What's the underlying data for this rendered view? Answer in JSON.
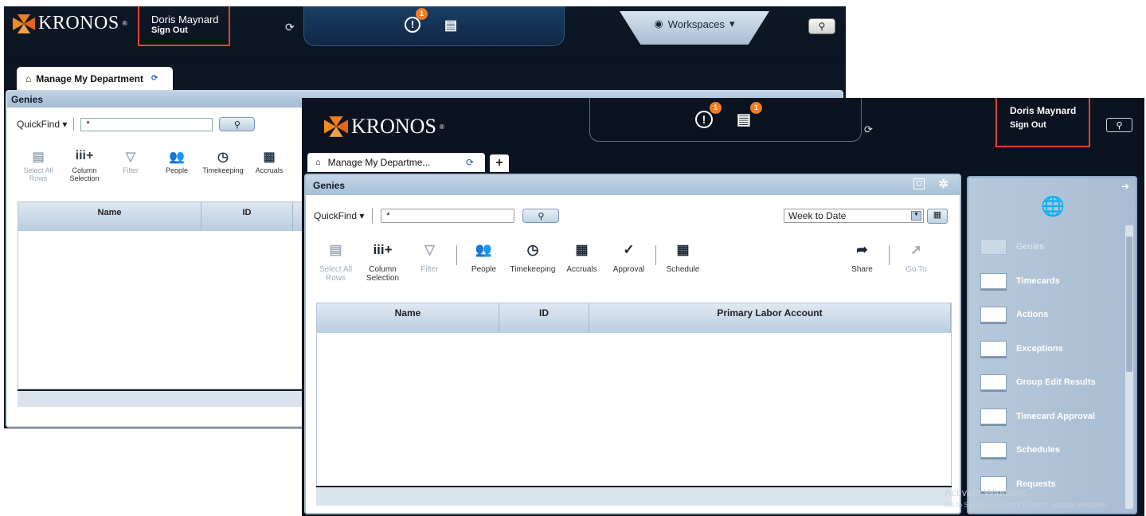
{
  "back": {
    "logo": "KRONOS",
    "logo_reg": "®",
    "user": {
      "name": "Doris Maynard",
      "signout": "Sign Out"
    },
    "notif_count": "1",
    "workspaces_label": "Workspaces",
    "tab": {
      "label": "Manage My Department"
    },
    "panel_title": "Genies",
    "quickfind": {
      "label": "QuickFind",
      "value": "*"
    },
    "tools": [
      {
        "label": "Select All Rows",
        "icon": "select-all-icon"
      },
      {
        "label": "Column Selection",
        "icon": "column-selection-icon"
      },
      {
        "label": "Filter",
        "icon": "filter-icon"
      },
      {
        "label": "People",
        "icon": "people-icon"
      },
      {
        "label": "Timekeeping",
        "icon": "timekeeping-icon"
      },
      {
        "label": "Accruals",
        "icon": "accruals-icon"
      }
    ],
    "columns": [
      "Name",
      "ID"
    ]
  },
  "front": {
    "logo": "KRONOS",
    "logo_reg": "®",
    "user": {
      "name": "Doris Maynard",
      "signout": "Sign Out"
    },
    "alert_count": "1",
    "tasks_count": "1",
    "tab": {
      "label": "Manage My Departme..."
    },
    "plus_label": "+",
    "panel_title": "Genies",
    "quickfind": {
      "label": "QuickFind",
      "value": "*"
    },
    "range": {
      "value": "Week to Date"
    },
    "tools": [
      {
        "label": "Select All Rows",
        "icon": "select-all-icon"
      },
      {
        "label": "Column Selection",
        "icon": "column-selection-icon"
      },
      {
        "label": "Filter",
        "icon": "filter-icon"
      },
      {
        "label": "People",
        "icon": "people-icon"
      },
      {
        "label": "Timekeeping",
        "icon": "timekeeping-icon"
      },
      {
        "label": "Accruals",
        "icon": "accruals-icon"
      },
      {
        "label": "Approval",
        "icon": "approval-icon"
      },
      {
        "label": "Schedule",
        "icon": "schedule-icon"
      }
    ],
    "share_label": "Share",
    "goto_label": "Go To",
    "columns": [
      "Name",
      "ID",
      "Primary Labor Account"
    ],
    "sidebar": [
      {
        "label": "Genies"
      },
      {
        "label": "Timecards"
      },
      {
        "label": "Actions"
      },
      {
        "label": "Exceptions"
      },
      {
        "label": "Group Edit Results"
      },
      {
        "label": "Timecard Approval"
      },
      {
        "label": "Schedules"
      },
      {
        "label": "Requests"
      }
    ],
    "watermark": {
      "title": "Activate Windows",
      "sub": "Go to System in Control Panel to activate Windows."
    }
  },
  "colors": {
    "accent_orange": "#ef7d22",
    "highlight_red": "#e2452b",
    "header_dark": "#0b1320",
    "panel_blue": "#a5bfd6"
  }
}
